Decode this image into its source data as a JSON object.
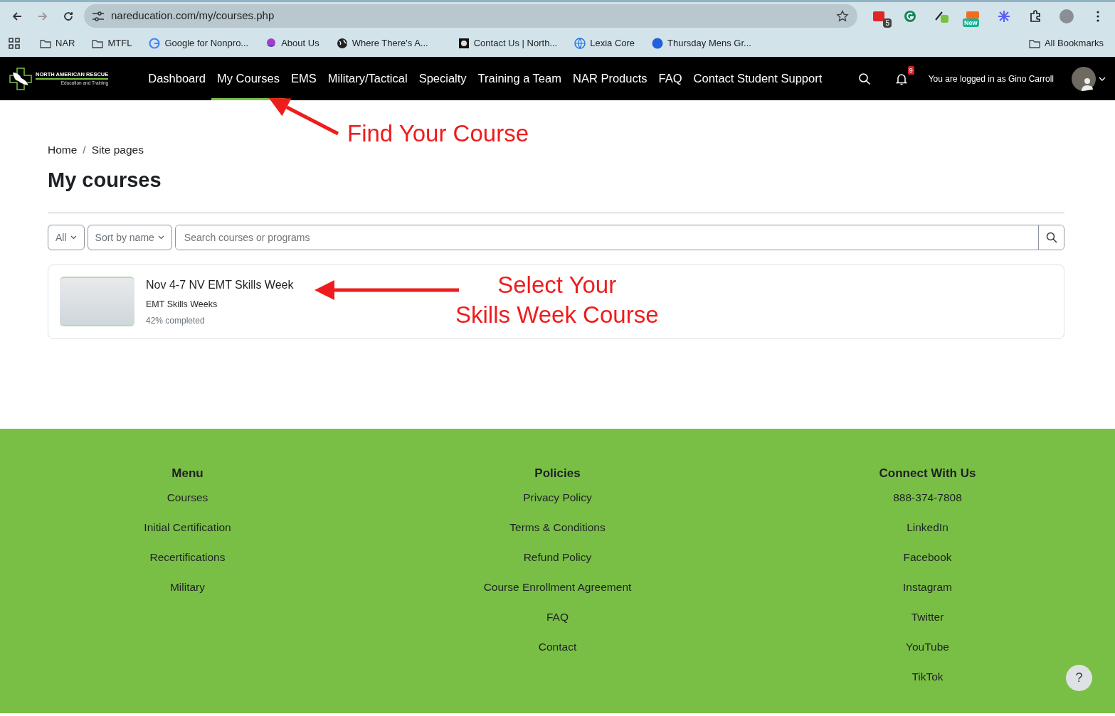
{
  "browser": {
    "url": "nareducation.com/my/courses.php",
    "bookmarks": [
      {
        "label": "NAR",
        "kind": "folder"
      },
      {
        "label": "MTFL",
        "kind": "folder"
      },
      {
        "label": "Google for Nonpro...",
        "kind": "google"
      },
      {
        "label": "About Us",
        "kind": "hands"
      },
      {
        "label": "Where There's A...",
        "kind": "globe"
      },
      {
        "label": "Contact Us | North...",
        "kind": "eagle"
      },
      {
        "label": "Lexia Core",
        "kind": "web"
      },
      {
        "label": "Thursday Mens Gr...",
        "kind": "zoom"
      }
    ],
    "all_bookmarks": "All Bookmarks",
    "extension_badges": [
      "5",
      "New"
    ]
  },
  "site": {
    "logo": {
      "name": "NORTH AMERICAN RESCUE",
      "tagline": "Education and Training"
    },
    "nav": [
      {
        "label": "Dashboard",
        "selected": false
      },
      {
        "label": "My Courses",
        "selected": true
      },
      {
        "label": "EMS",
        "selected": false
      },
      {
        "label": "Military/Tactical",
        "selected": false
      },
      {
        "label": "Specialty",
        "selected": false
      },
      {
        "label": "Training a Team",
        "selected": false
      },
      {
        "label": "NAR Products",
        "selected": false
      },
      {
        "label": "FAQ",
        "selected": false
      },
      {
        "label": "Contact Student Support",
        "selected": false
      }
    ],
    "notification_count": "9",
    "login_text": "You are logged in as Gino Carroll"
  },
  "breadcrumb": [
    "Home",
    "Site pages"
  ],
  "breadcrumb_separator": "/",
  "heading": "My courses",
  "filters": {
    "type": "All",
    "sort": "Sort by name",
    "search_placeholder": "Search courses or programs"
  },
  "courses": [
    {
      "title": "Nov 4-7 NV EMT Skills Week",
      "category": "EMT Skills Weeks",
      "progress": "42% completed"
    }
  ],
  "annotations": [
    {
      "lines": [
        "Find Your Course"
      ]
    },
    {
      "lines": [
        "Select Your",
        "Skills Week Course"
      ]
    }
  ],
  "footer": {
    "columns": [
      {
        "title": "Menu",
        "links": [
          "Courses",
          "Initial Certification",
          "Recertifications",
          "Military"
        ]
      },
      {
        "title": "Policies",
        "links": [
          "Privacy Policy",
          "Terms & Conditions",
          "Refund Policy",
          "Course Enrollment Agreement",
          "FAQ",
          "Contact"
        ]
      },
      {
        "title": "Connect With Us",
        "links": [
          "888-374-7808",
          "LinkedIn",
          "Facebook",
          "Instagram",
          "Twitter",
          "YouTube",
          "TikTok"
        ]
      }
    ]
  },
  "help_button": "?"
}
